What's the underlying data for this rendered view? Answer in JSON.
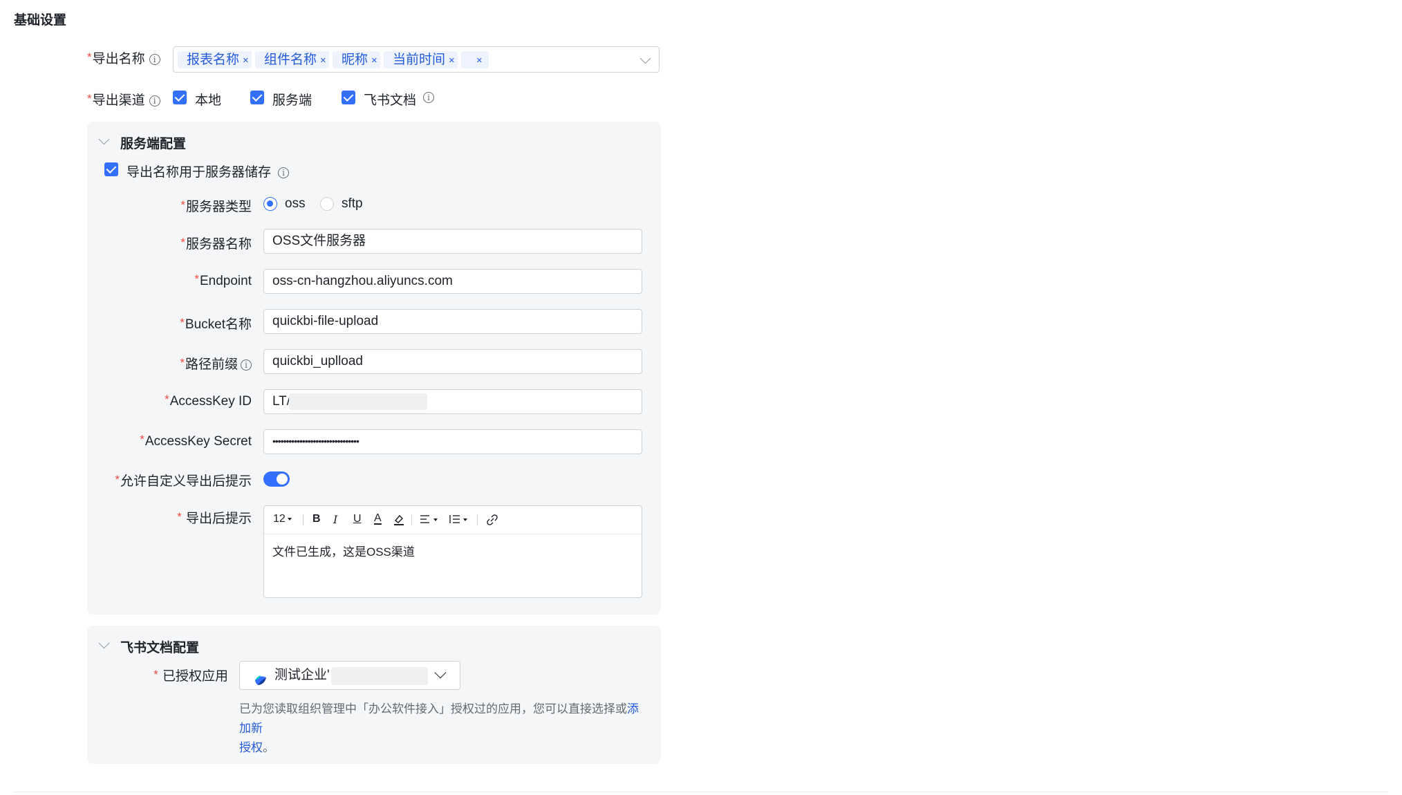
{
  "section_title": "基础设置",
  "export_name": {
    "label": "导出名称",
    "required": "*",
    "info": "i",
    "tags": [
      "报表名称",
      "组件名称",
      "昵称",
      "当前时间",
      ""
    ],
    "tag_close": "×"
  },
  "export_channel": {
    "label": "导出渠道",
    "required": "*",
    "info": "i",
    "options": [
      {
        "label": "本地",
        "checked": true
      },
      {
        "label": "服务端",
        "checked": true
      },
      {
        "label": "飞书文档",
        "checked": true
      }
    ]
  },
  "server_panel": {
    "title": "服务端配置",
    "use_name_checkbox_label": "导出名称用于服务器储存",
    "server_type": {
      "label": "服务器类型",
      "options": [
        "oss",
        "sftp"
      ],
      "selected": "oss"
    },
    "server_name": {
      "label": "服务器名称",
      "value": "OSS文件服务器"
    },
    "endpoint": {
      "label": "Endpoint",
      "value": "oss-cn-hangzhou.aliyuncs.com"
    },
    "bucket": {
      "label": "Bucket名称",
      "value": "quickbi-file-upload"
    },
    "path_prefix": {
      "label": "路径前缀",
      "value": "quickbi_uplload"
    },
    "access_key_id": {
      "label": "AccessKey ID",
      "value": "LT/"
    },
    "access_key_secret": {
      "label": "AccessKey Secret",
      "value": "••••••••••••••••••••••••••••••••"
    },
    "allow_custom_tip": {
      "label": "允许自定义导出后提示",
      "enabled": true
    },
    "post_export_tip": {
      "label": "导出后提示",
      "toolbar": {
        "font_size": "12",
        "bold": "B",
        "italic": "I",
        "underline": "U",
        "font_color": "A"
      },
      "content": "文件已生成，这是OSS渠道"
    }
  },
  "feishu_panel": {
    "title": "飞书文档配置",
    "authorized_app": {
      "label": "已授权应用",
      "value": "测试企业'"
    },
    "hint_text": "已为您读取组织管理中「办公软件接入」授权过的应用，您可以直接选择或",
    "hint_link_1": "添加新",
    "hint_link_2": "授权",
    "hint_tail": "。"
  },
  "colors": {
    "accent": "#3370ff",
    "required": "#f54a45",
    "tag_text": "#245bdb",
    "panel_bg": "#f5f6f7"
  }
}
